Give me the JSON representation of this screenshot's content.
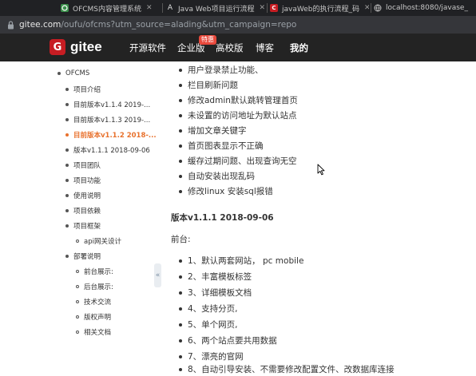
{
  "browser": {
    "tabs": [
      {
        "title": "OFCMS内容管理系统",
        "favicon_color": "#3a8f4a",
        "favicon": "gitee-icon"
      },
      {
        "title": "Java Web项目运行流程",
        "favicon_color": "#444444",
        "favicon": "a-icon"
      },
      {
        "title": "javaWeb的执行流程_码",
        "favicon_color": "#c71d23",
        "favicon": "csdn-icon"
      },
      {
        "title": "localhost:8080/javase_",
        "favicon_color": "#777777",
        "favicon": "globe-icon"
      }
    ],
    "url_host": "gitee.com",
    "url_path": "/oufu/ofcms?utm_source=alading&utm_campaign=repo"
  },
  "site": {
    "logo_text": "gitee",
    "logo_letter": "G",
    "nav": [
      "开源软件",
      "企业版",
      "高校版",
      "博客",
      "我的"
    ],
    "badge": "特惠",
    "brand_color": "#c71d23"
  },
  "sidebar": {
    "root": "OFCMS",
    "items": [
      "项目介绍",
      "目前版本v1.1.4 2019-...",
      "目前版本v1.1.3 2019-...",
      "目前版本v1.1.2 2018-...",
      "版本v1.1.1 2018-09-06",
      "项目团队",
      "项目功能",
      "使用说明",
      "项目依赖",
      "项目框架",
      "api网关设计",
      "部署说明",
      "前台展示:",
      "后台展示:",
      "技术交流",
      "版权声明",
      "相关文档"
    ],
    "active_color": "#e8712c",
    "collapse_glyph": "«"
  },
  "main": {
    "bullets_top": [
      "用户登录禁止功能、",
      "栏目刷新问题",
      "修改admin默认跳转管理首页",
      "未设置的访问地址为默认站点",
      "增加文章关键字",
      "首页图表显示不正确",
      "缓存过期问题、出现查询无空",
      "自动安装出现乱码",
      "修改linux 安装sql报错"
    ],
    "heading": "版本v1.1.1 2018-09-06",
    "para": "前台:",
    "bullets_bottom": [
      "1、默认两套网站， pc mobile",
      "2、丰富模板标签",
      "3、详细模板文档",
      "4、支持分页,",
      "5、单个网页,",
      "6、两个站点要共用数据",
      "7、漂亮的官网",
      "8、自动引导安装、不需要修改配置文件、改数据库连接"
    ]
  }
}
